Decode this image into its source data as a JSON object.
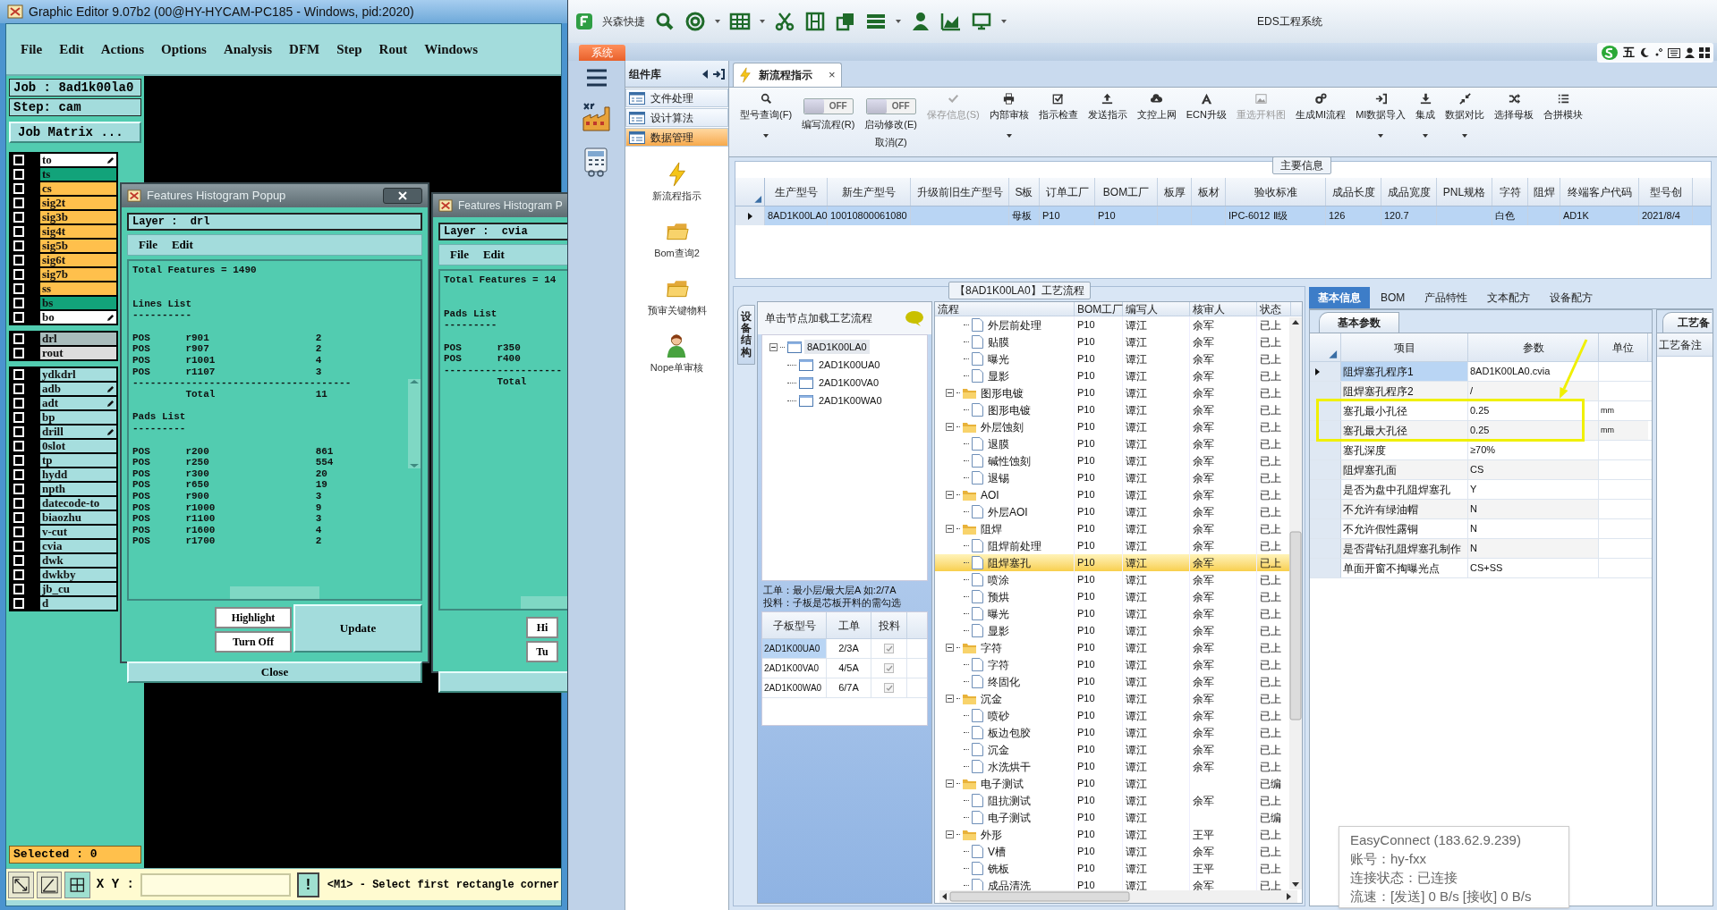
{
  "editor": {
    "title": "Graphic Editor 9.07b2 (00@HY-HYCAM-PC185 - Windows, pid:2020)",
    "menu": [
      "File",
      "Edit",
      "Actions",
      "Options",
      "Analysis",
      "DFM",
      "Step",
      "Rout",
      "Windows"
    ],
    "job": "Job : 8ad1k00la0",
    "step": "Step: cam",
    "job_matrix": "Job Matrix ...",
    "layer_groups": [
      [
        {
          "name": "to",
          "color": "#ffffff",
          "edit_mark": true,
          "checked": false
        },
        {
          "name": "ts",
          "color": "#12a37a",
          "edit_mark": false,
          "checked": false
        },
        {
          "name": "cs",
          "color": "#ffc04c",
          "edit_mark": false,
          "checked": false
        },
        {
          "name": "sig2t",
          "color": "#ffc04c",
          "edit_mark": false,
          "checked": false
        },
        {
          "name": "sig3b",
          "color": "#ffc04c",
          "edit_mark": false,
          "checked": false
        },
        {
          "name": "sig4t",
          "color": "#ffc04c",
          "edit_mark": false,
          "checked": false
        },
        {
          "name": "sig5b",
          "color": "#ffc04c",
          "edit_mark": false,
          "checked": false
        },
        {
          "name": "sig6t",
          "color": "#ffc04c",
          "edit_mark": false,
          "checked": false
        },
        {
          "name": "sig7b",
          "color": "#ffc04c",
          "edit_mark": false,
          "checked": false
        },
        {
          "name": "ss",
          "color": "#ffc04c",
          "edit_mark": false,
          "checked": false
        },
        {
          "name": "bs",
          "color": "#12a37a",
          "edit_mark": false,
          "checked": false
        },
        {
          "name": "bo",
          "color": "#ffffff",
          "edit_mark": true,
          "checked": false
        }
      ],
      [
        {
          "name": "drl",
          "color": "#a9bcbc",
          "edit_mark": false,
          "checked": false
        },
        {
          "name": "rout",
          "color": "#dcdcdc",
          "edit_mark": false,
          "checked": false
        }
      ],
      [
        {
          "name": "ydkdrl",
          "color": "#a6dede",
          "edit_mark": false,
          "checked": false
        },
        {
          "name": "adb",
          "color": "#a6dede",
          "edit_mark": true,
          "checked": false
        },
        {
          "name": "adt",
          "color": "#a6dede",
          "edit_mark": true,
          "checked": false
        },
        {
          "name": "bp",
          "color": "#a6dede",
          "edit_mark": false,
          "checked": false
        },
        {
          "name": "drill",
          "color": "#a6dede",
          "edit_mark": true,
          "checked": false
        },
        {
          "name": "0slot",
          "color": "#a6dede",
          "edit_mark": false,
          "checked": false
        },
        {
          "name": "tp",
          "color": "#a6dede",
          "edit_mark": false,
          "checked": false
        },
        {
          "name": "hydd",
          "color": "#a6dede",
          "edit_mark": false,
          "checked": false
        },
        {
          "name": "npth",
          "color": "#a6dede",
          "edit_mark": false,
          "checked": false
        },
        {
          "name": "datecode-to",
          "color": "#a6dede",
          "edit_mark": false,
          "checked": false
        },
        {
          "name": "biaozhu",
          "color": "#a6dede",
          "edit_mark": false,
          "checked": false
        },
        {
          "name": "v-cut",
          "color": "#a6dede",
          "edit_mark": false,
          "checked": false
        },
        {
          "name": "cvia",
          "color": "#a6dede",
          "edit_mark": false,
          "checked": false
        },
        {
          "name": "dwk",
          "color": "#a6dede",
          "edit_mark": false,
          "checked": false
        },
        {
          "name": "dwkby",
          "color": "#a6dede",
          "edit_mark": false,
          "checked": false
        },
        {
          "name": "jb_cu",
          "color": "#a6dede",
          "edit_mark": false,
          "checked": false
        },
        {
          "name": "d",
          "color": "#a6dede",
          "edit_mark": false,
          "checked": false
        }
      ]
    ],
    "selected": "Selected : 0",
    "xy_label": "X Y :",
    "alert_button": "!",
    "status": "<M1> - Select first rectangle corner"
  },
  "popups": [
    {
      "title": "Features Histogram Popup",
      "layer": "Layer :  drl",
      "menu": [
        "File",
        "Edit"
      ],
      "blocks": [
        [
          "Total Features = 1490"
        ],
        [
          "Lines List",
          "----------"
        ],
        [
          "POS      r901                  2",
          "POS      r907                  2",
          "POS      r1001                 4",
          "POS      r1107                 3",
          "-------------------------------------",
          "         Total                 11"
        ],
        [
          "Pads List",
          "---------"
        ],
        [
          "POS      r200                  861",
          "POS      r250                  554",
          "POS      r300                  20",
          "POS      r650                  19",
          "POS      r900                  3",
          "POS      r1000                 9",
          "POS      r1100                 3",
          "POS      r1600                 4",
          "POS      r1700                 2"
        ]
      ],
      "highlight": "Highlight",
      "turn_off": "Turn Off",
      "update": "Update",
      "close": "Close"
    },
    {
      "title": "Features Histogram P",
      "layer": "Layer :  cvia",
      "menu": [
        "File",
        "Edit"
      ],
      "blocks": [
        [
          "Total Features = 14"
        ],
        [
          "Pads List",
          "---------"
        ],
        [
          "POS      r350",
          "POS      r400",
          "--------------------",
          "         Total"
        ]
      ],
      "highlight": "Hi",
      "turn_off": "Tu"
    }
  ],
  "eds": {
    "brand": "兴森快捷",
    "title": "EDS工程系统",
    "ime_mode": "五",
    "system_tab": "系统",
    "library": {
      "title": "组件库",
      "categories": [
        {
          "label": "文件处理",
          "selected": false
        },
        {
          "label": "设计算法",
          "selected": false
        },
        {
          "label": "数据管理",
          "selected": true
        }
      ],
      "launchers": [
        {
          "label": "新流程指示",
          "kind": "lightning"
        },
        {
          "label": "Bom查询2",
          "kind": "folder"
        },
        {
          "label": "预审关键物料",
          "kind": "folder"
        },
        {
          "label": "Nope单审核",
          "kind": "person"
        }
      ]
    },
    "doc_tab": {
      "label": "新流程指示",
      "close": "×"
    },
    "toolbar": [
      {
        "kind": "button",
        "label": "型号查询(F)",
        "dropdown": true,
        "disabled": false
      },
      {
        "kind": "toggle",
        "label": "编写流程(R)",
        "switch_text": "OFF",
        "on": false
      },
      {
        "kind": "toggle",
        "label": "启动修改(E)",
        "sub_label": "取消(Z)",
        "switch_text": "OFF",
        "on": false
      },
      {
        "kind": "button",
        "label": "保存信息(S)",
        "dropdown": false,
        "disabled": true
      },
      {
        "kind": "button",
        "label": "内部审核",
        "dropdown": true,
        "disabled": false
      },
      {
        "kind": "button",
        "label": "指示检查",
        "dropdown": false,
        "disabled": false
      },
      {
        "kind": "button",
        "label": "发送指示",
        "dropdown": false,
        "disabled": false
      },
      {
        "kind": "button",
        "label": "文控上网",
        "dropdown": false,
        "disabled": false
      },
      {
        "kind": "button",
        "label": "ECN升级",
        "dropdown": false,
        "disabled": false
      },
      {
        "kind": "button",
        "label": "重选开料图",
        "dropdown": false,
        "disabled": true
      },
      {
        "kind": "button",
        "label": "生成MI流程",
        "dropdown": false,
        "disabled": false
      },
      {
        "kind": "button",
        "label": "MI数据导入",
        "dropdown": true,
        "disabled": false
      },
      {
        "kind": "button",
        "label": "集成",
        "dropdown": true,
        "disabled": false
      },
      {
        "kind": "button",
        "label": "数据对比",
        "dropdown": true,
        "disabled": false
      },
      {
        "kind": "button",
        "label": "选择母板",
        "dropdown": false,
        "disabled": false
      },
      {
        "kind": "button",
        "label": "合拼模块",
        "dropdown": false,
        "disabled": false
      }
    ],
    "main_info": {
      "legend": "主要信息",
      "columns": [
        "生产型号",
        "新生产型号",
        "升级前旧生产型号",
        "S板",
        "订单工厂",
        "BOM工厂",
        "板厚",
        "板材",
        "验收标准",
        "成品长度",
        "成品宽度",
        "PNL规格",
        "字符",
        "阻焊",
        "终端客户代码",
        "型号创"
      ],
      "rows": [
        {
          "selected": true,
          "cells": [
            "8AD1K00LA0",
            "10010800061080",
            null,
            "母板",
            "P10",
            "P10",
            null,
            null,
            "IPC-6012 Ⅱ级",
            "126",
            "120.7",
            null,
            "白色",
            null,
            "AD1K",
            "2021/8/4"
          ]
        }
      ]
    },
    "process": {
      "legend": "【8AD1K00LA0】工艺流程",
      "side_tab": "设备结构",
      "tree_hint": "单击节点加载工艺流程",
      "tree": [
        {
          "label": "8AD1K00LA0",
          "selected": true,
          "expanded": true,
          "children": [
            {
              "label": "2AD1K00UA0",
              "selected": false
            },
            {
              "label": "2AD1K00VA0",
              "selected": false
            },
            {
              "label": "2AD1K00WA0",
              "selected": false
            }
          ]
        }
      ],
      "notes": [
        "工单：最小层/最大层A 如:2/7A",
        "投料：子板是芯板开料的需勾选"
      ],
      "sub_boards": {
        "columns": [
          "子板型号",
          "工单",
          "投料"
        ],
        "rows": [
          {
            "board": "2AD1K00UA0",
            "order": "2/3A",
            "checked": true,
            "selected": true
          },
          {
            "board": "2AD1K00VA0",
            "order": "4/5A",
            "checked": true,
            "selected": false
          },
          {
            "board": "2AD1K00WA0",
            "order": "6/7A",
            "checked": true,
            "selected": false
          }
        ]
      },
      "flow": {
        "columns": [
          "流程",
          "BOM工厂",
          "编写人",
          "核审人",
          "状态"
        ],
        "rows": [
          {
            "children": [
              {
                "label": "外层前处理",
                "bom": "P10",
                "author": "谭江",
                "reviewer": "余军",
                "status": "已上",
                "selected": false
              },
              {
                "label": "贴膜",
                "bom": "P10",
                "author": "谭江",
                "reviewer": "余军",
                "status": "已上",
                "selected": false
              },
              {
                "label": "曝光",
                "bom": "P10",
                "author": "谭江",
                "reviewer": "余军",
                "status": "已上",
                "selected": false
              },
              {
                "label": "显影",
                "bom": "P10",
                "author": "谭江",
                "reviewer": "余军",
                "status": "已上",
                "selected": false
              }
            ]
          },
          {
            "label": "图形电镀",
            "bom": "P10",
            "author": "谭江",
            "reviewer": "余军",
            "status": "已上",
            "selected": false,
            "expanded": true,
            "children": [
              {
                "label": "图形电镀",
                "bom": "P10",
                "author": "谭江",
                "reviewer": "余军",
                "status": "已上",
                "selected": false
              }
            ]
          },
          {
            "label": "外层蚀刻",
            "bom": "P10",
            "author": "谭江",
            "reviewer": "余军",
            "status": "已上",
            "selected": false,
            "expanded": true,
            "children": [
              {
                "label": "退膜",
                "bom": "P10",
                "author": "谭江",
                "reviewer": "余军",
                "status": "已上",
                "selected": false
              },
              {
                "label": "碱性蚀刻",
                "bom": "P10",
                "author": "谭江",
                "reviewer": "余军",
                "status": "已上",
                "selected": false
              },
              {
                "label": "退锡",
                "bom": "P10",
                "author": "谭江",
                "reviewer": "余军",
                "status": "已上",
                "selected": false
              }
            ]
          },
          {
            "label": "AOI",
            "bom": "P10",
            "author": "谭江",
            "reviewer": "余军",
            "status": "已上",
            "selected": false,
            "expanded": true,
            "children": [
              {
                "label": "外层AOI",
                "bom": "P10",
                "author": "谭江",
                "reviewer": "余军",
                "status": "已上",
                "selected": false
              }
            ]
          },
          {
            "label": "阻焊",
            "bom": "P10",
            "author": "谭江",
            "reviewer": "余军",
            "status": "已上",
            "selected": false,
            "expanded": true,
            "children": [
              {
                "label": "阻焊前处理",
                "bom": "P10",
                "author": "谭江",
                "reviewer": "余军",
                "status": "已上",
                "selected": false
              },
              {
                "label": "阻焊塞孔",
                "bom": "P10",
                "author": "谭江",
                "reviewer": "余军",
                "status": "已上",
                "selected": true
              },
              {
                "label": "喷涂",
                "bom": "P10",
                "author": "谭江",
                "reviewer": "余军",
                "status": "已上",
                "selected": false
              },
              {
                "label": "预烘",
                "bom": "P10",
                "author": "谭江",
                "reviewer": "余军",
                "status": "已上",
                "selected": false
              },
              {
                "label": "曝光",
                "bom": "P10",
                "author": "谭江",
                "reviewer": "余军",
                "status": "已上",
                "selected": false
              },
              {
                "label": "显影",
                "bom": "P10",
                "author": "谭江",
                "reviewer": "余军",
                "status": "已上",
                "selected": false
              }
            ]
          },
          {
            "label": "字符",
            "bom": "P10",
            "author": "谭江",
            "reviewer": "余军",
            "status": "已上",
            "selected": false,
            "expanded": true,
            "children": [
              {
                "label": "字符",
                "bom": "P10",
                "author": "谭江",
                "reviewer": "余军",
                "status": "已上",
                "selected": false
              },
              {
                "label": "终固化",
                "bom": "P10",
                "author": "谭江",
                "reviewer": "余军",
                "status": "已上",
                "selected": false
              }
            ]
          },
          {
            "label": "沉金",
            "bom": "P10",
            "author": "谭江",
            "reviewer": "余军",
            "status": "已上",
            "selected": false,
            "expanded": true,
            "children": [
              {
                "label": "喷砂",
                "bom": "P10",
                "author": "谭江",
                "reviewer": "余军",
                "status": "已上",
                "selected": false
              },
              {
                "label": "板边包胶",
                "bom": "P10",
                "author": "谭江",
                "reviewer": "余军",
                "status": "已上",
                "selected": false
              },
              {
                "label": "沉金",
                "bom": "P10",
                "author": "谭江",
                "reviewer": "余军",
                "status": "已上",
                "selected": false
              },
              {
                "label": "水洗烘干",
                "bom": "P10",
                "author": "谭江",
                "reviewer": "余军",
                "status": "已上",
                "selected": false
              }
            ]
          },
          {
            "label": "电子测试",
            "bom": "P10",
            "author": "谭江",
            "status": "已编",
            "selected": false,
            "expanded": true,
            "children": [
              {
                "label": "阻抗测试",
                "bom": "P10",
                "author": "谭江",
                "reviewer": "余军",
                "status": "已上",
                "selected": false
              },
              {
                "label": "电子测试",
                "bom": "P10",
                "author": "谭江",
                "status": "已编",
                "selected": false
              }
            ]
          },
          {
            "label": "外形",
            "bom": "P10",
            "author": "谭江",
            "reviewer": "王平",
            "status": "已上",
            "selected": false,
            "expanded": true,
            "children": [
              {
                "label": "V槽",
                "bom": "P10",
                "author": "谭江",
                "reviewer": "余军",
                "status": "已上",
                "selected": false
              },
              {
                "label": "铣板",
                "bom": "P10",
                "author": "谭江",
                "reviewer": "王平",
                "status": "已上",
                "selected": false
              },
              {
                "label": "成品清洗",
                "bom": "P10",
                "author": "谭江",
                "reviewer": "余军",
                "status": "已上",
                "selected": false
              }
            ]
          }
        ]
      }
    },
    "details": {
      "tabs": [
        {
          "label": "基本信息",
          "selected": true
        },
        {
          "label": "BOM",
          "selected": false
        },
        {
          "label": "产品特性",
          "selected": false
        },
        {
          "label": "文本配方",
          "selected": false
        },
        {
          "label": "设备配方",
          "selected": false
        }
      ],
      "subtab": "基本参数",
      "columns": [
        "项目",
        "参数",
        "单位"
      ],
      "rows": [
        {
          "item": "阻焊塞孔程序1",
          "value": "8AD1K00LA0.cvia",
          "selected": true
        },
        {
          "item": "阻焊塞孔程序2",
          "value": "/",
          "selected": false
        },
        {
          "item": "塞孔最小孔径",
          "value": "0.25",
          "unit": "mm",
          "selected": false
        },
        {
          "item": "塞孔最大孔径",
          "value": "0.25",
          "unit": "mm",
          "selected": false
        },
        {
          "item": "塞孔深度",
          "value": "≥70%",
          "selected": false
        },
        {
          "item": "阻焊塞孔面",
          "value": "CS",
          "selected": false
        },
        {
          "item": "是否为盘中孔阻焊塞孔",
          "value": "Y",
          "selected": false
        },
        {
          "item": "不允许有绿油帽",
          "value": "N",
          "selected": false
        },
        {
          "item": "不允许假性露铜",
          "value": "N",
          "selected": false
        },
        {
          "item": "是否背钻孔阻焊塞孔制作",
          "value": "N",
          "selected": false
        },
        {
          "item": "单面开窗不掏曝光点",
          "value": "CS+SS",
          "selected": false
        }
      ],
      "side_tab": "工艺备",
      "side_column": "工艺备注"
    },
    "tooltip": [
      "EasyConnect (183.62.9.239)",
      "账号：hy-fxx",
      "连接状态：已连接",
      "流速：[发送] 0 B/s [接收] 0 B/s"
    ]
  }
}
